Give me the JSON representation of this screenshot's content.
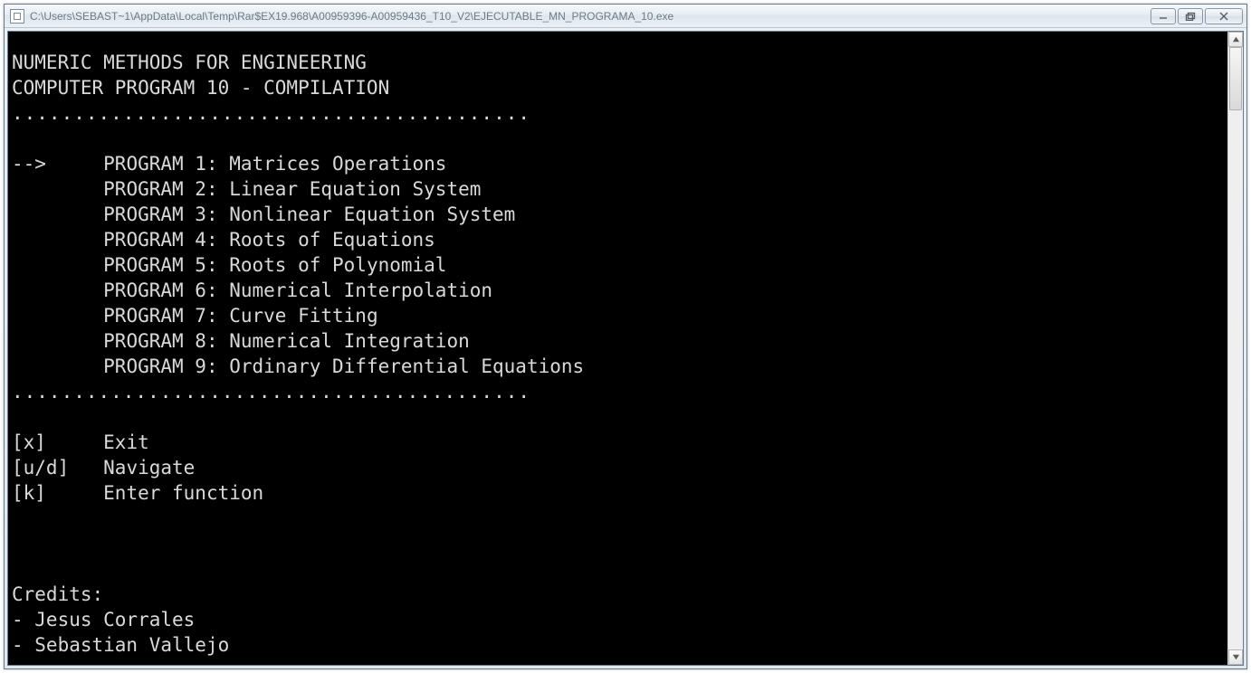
{
  "window": {
    "title": "C:\\Users\\SEBAST~1\\AppData\\Local\\Temp\\Rar$EX19.968\\A00959396-A00959436_T10_V2\\EJECUTABLE_MN_PROGRAMA_10.exe"
  },
  "header": {
    "line1": "NUMERIC METHODS FOR ENGINEERING",
    "line2": "COMPUTER PROGRAM 10 - COMPILATION"
  },
  "divider": "..........................................",
  "selected_marker": "-->",
  "selected_index": 0,
  "programs": [
    {
      "label": "PROGRAM 1",
      "desc": "Matrices Operations"
    },
    {
      "label": "PROGRAM 2",
      "desc": "Linear Equation System"
    },
    {
      "label": "PROGRAM 3",
      "desc": "Nonlinear Equation System"
    },
    {
      "label": "PROGRAM 4",
      "desc": "Roots of Equations"
    },
    {
      "label": "PROGRAM 5",
      "desc": "Roots of Polynomial"
    },
    {
      "label": "PROGRAM 6",
      "desc": "Numerical Interpolation"
    },
    {
      "label": "PROGRAM 7",
      "desc": "Curve Fitting"
    },
    {
      "label": "PROGRAM 8",
      "desc": "Numerical Integration"
    },
    {
      "label": "PROGRAM 9",
      "desc": "Ordinary Differential Equations"
    }
  ],
  "controls": [
    {
      "key": "[x]",
      "action": "Exit"
    },
    {
      "key": "[u/d]",
      "action": "Navigate"
    },
    {
      "key": "[k]",
      "action": "Enter function"
    }
  ],
  "credits": {
    "heading": "Credits:",
    "people": [
      "Jesus Corrales",
      "Sebastian Vallejo"
    ]
  }
}
